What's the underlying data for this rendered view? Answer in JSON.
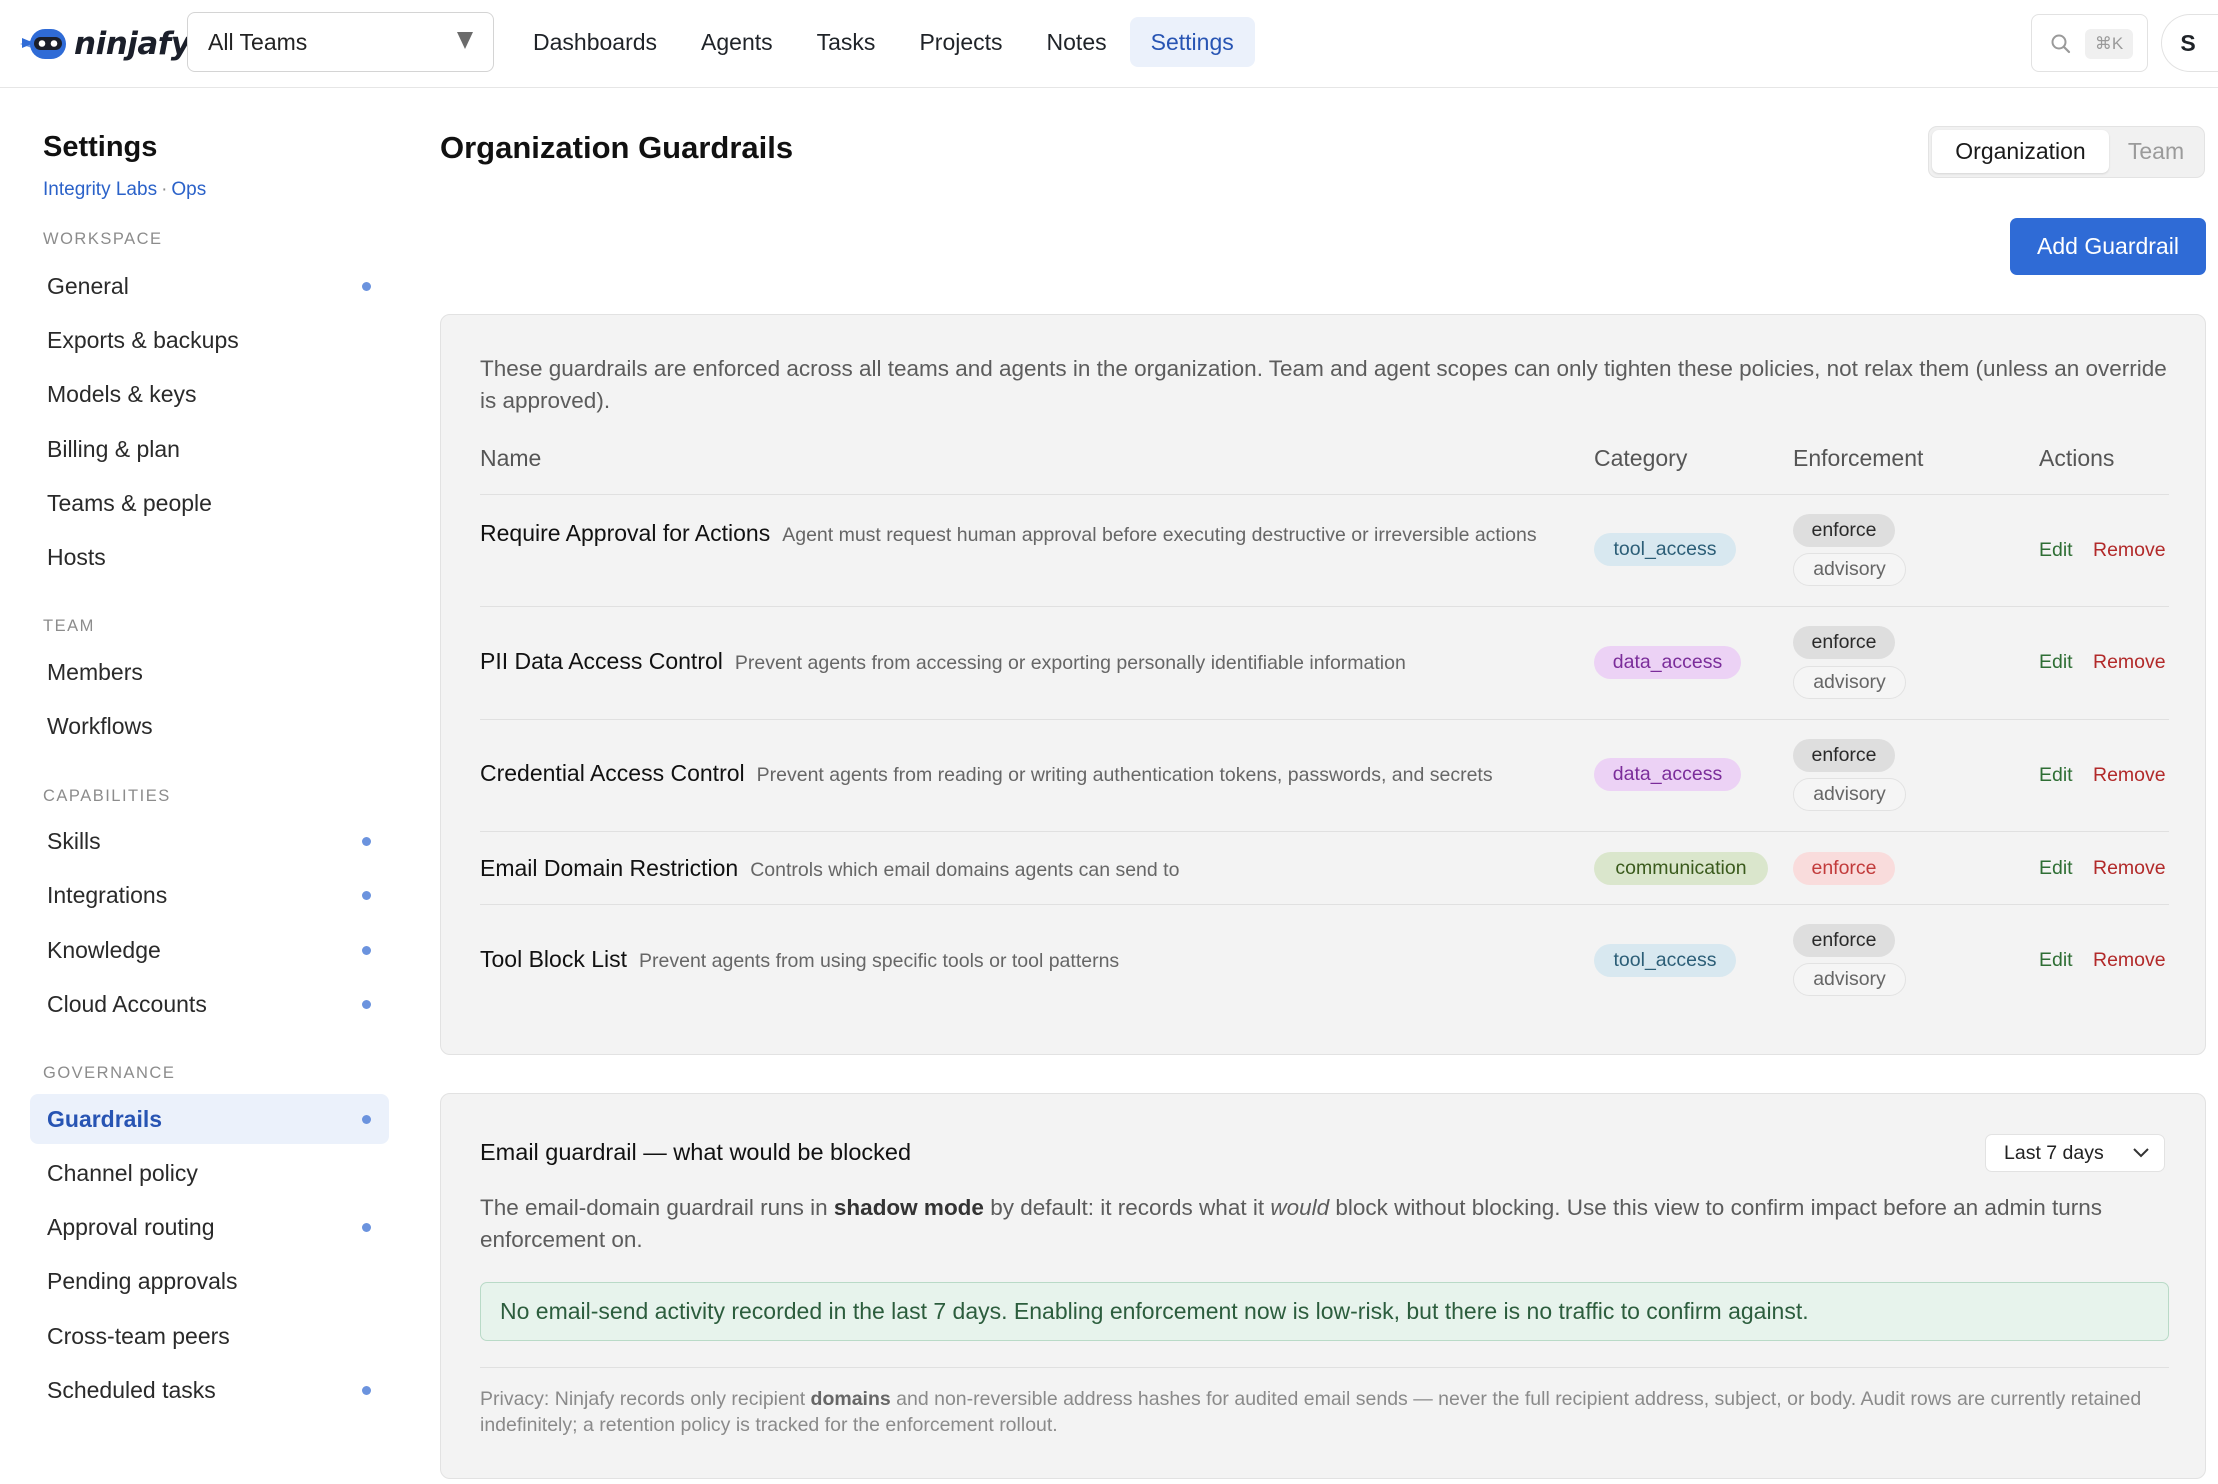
{
  "brand": {
    "name": "ninjafy",
    "accent": "#2f6bd6"
  },
  "team_select": {
    "value": "All Teams"
  },
  "nav": {
    "items": [
      "Dashboards",
      "Agents",
      "Tasks",
      "Projects",
      "Notes",
      "Settings"
    ],
    "active": "Settings"
  },
  "search": {
    "shortcut": "⌘K"
  },
  "user": {
    "initial": "S"
  },
  "sidebar": {
    "title": "Settings",
    "org": "Integrity Labs",
    "team": "Ops",
    "sep": "·",
    "sections": {
      "workspace": "WORKSPACE",
      "team": "TEAM",
      "capabilities": "CAPABILITIES",
      "governance": "GOVERNANCE"
    },
    "items": {
      "general": "General",
      "exports": "Exports & backups",
      "models": "Models & keys",
      "billing": "Billing & plan",
      "teams_people": "Teams & people",
      "hosts": "Hosts",
      "members": "Members",
      "workflows": "Workflows",
      "skills": "Skills",
      "integrations": "Integrations",
      "knowledge": "Knowledge",
      "cloud_accounts": "Cloud Accounts",
      "guardrails": "Guardrails",
      "channel_policy": "Channel policy",
      "approval_routing": "Approval routing",
      "pending_approvals": "Pending approvals",
      "cross_team_peers": "Cross-team peers",
      "scheduled_tasks": "Scheduled tasks"
    }
  },
  "page": {
    "title": "Organization Guardrails",
    "scope_toggle": {
      "organization": "Organization",
      "team": "Team",
      "active": "Organization"
    },
    "add_button": "Add Guardrail"
  },
  "guardrails": {
    "intro": "These guardrails are enforced across all teams and agents in the organization. Team and agent scopes can only tighten these policies, not relax them (unless an override is approved).",
    "columns": {
      "name": "Name",
      "category": "Category",
      "enforcement": "Enforcement",
      "actions": "Actions"
    },
    "edit_label": "Edit",
    "remove_label": "Remove",
    "enforce_label": "enforce",
    "advisory_label": "advisory",
    "rows": [
      {
        "name": "Require Approval for Actions",
        "description": "Agent must request human approval before executing destructive or irreversible actions",
        "category": "tool_access"
      },
      {
        "name": "PII Data Access Control",
        "description": "Prevent agents from accessing or exporting personally identifiable information",
        "category": "data_access"
      },
      {
        "name": "Credential Access Control",
        "description": "Prevent agents from reading or writing authentication tokens, passwords, and secrets",
        "category": "data_access"
      },
      {
        "name": "Email Domain Restriction",
        "description": "Controls which email domains agents can send to",
        "category": "communication"
      },
      {
        "name": "Tool Block List",
        "description": "Prevent agents from using specific tools or tool patterns",
        "category": "tool_access"
      }
    ]
  },
  "email_panel": {
    "title": "Email guardrail — what would be blocked",
    "range": "Last 7 days",
    "body_1": "The email-domain guardrail runs in ",
    "body_bold": "shadow mode",
    "body_2": " by default: it records what it ",
    "body_em": "would",
    "body_3": " block without blocking. Use this view to confirm impact before an admin turns enforcement on.",
    "notice": "No email-send activity recorded in the last 7 days. Enabling enforcement now is low-risk, but there is no traffic to confirm against.",
    "privacy_1": "Privacy: Ninjafy records only recipient ",
    "privacy_bold": "domains",
    "privacy_2": " and non-reversible address hashes for audited email sends — never the full recipient address, subject, or body. Audit rows are currently retained indefinitely; a retention policy is tracked for the enforcement rollout."
  }
}
